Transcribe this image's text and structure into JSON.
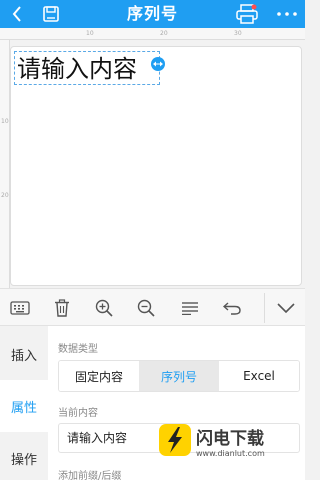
{
  "header": {
    "title": "序列号"
  },
  "icons": {
    "back": "chevron-left-icon",
    "save": "save-icon",
    "print": "printer-icon",
    "more": "more-dots-icon",
    "toolbar": [
      "keyboard-icon",
      "trash-icon",
      "zoom-in-icon",
      "zoom-out-icon",
      "align-icon",
      "undo-icon",
      "chevron-down-icon"
    ]
  },
  "ruler": {
    "top_marks": [
      "10",
      "20",
      "30"
    ],
    "left_marks": [
      "10",
      "20"
    ]
  },
  "canvas": {
    "text_element": "请输入内容"
  },
  "side_tabs": [
    "插入",
    "属性",
    "操作"
  ],
  "active_side_tab": "属性",
  "panel": {
    "data_type_label": "数据类型",
    "data_type_options": [
      "固定内容",
      "序列号",
      "Excel"
    ],
    "data_type_selected": "序列号",
    "current_content_label": "当前内容",
    "current_content_value": "请输入内容",
    "prefix_suffix_label": "添加前缀/后缀"
  },
  "watermark": {
    "site": "闪电下载",
    "url": "www.dianlut.com"
  },
  "colors": {
    "accent": "#1f9ef2",
    "header_bg": "#1f9ef2"
  }
}
